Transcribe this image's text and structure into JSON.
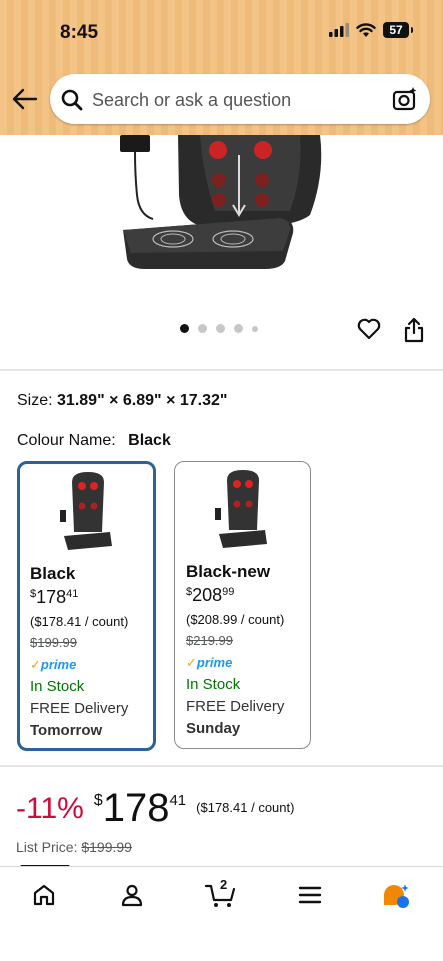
{
  "status_bar": {
    "time": "8:45",
    "battery": "57"
  },
  "search": {
    "placeholder": "Search or ask a question"
  },
  "icons": {
    "back": "back-arrow-icon",
    "search": "search-icon",
    "camera": "camera-search-icon",
    "heart": "heart-icon",
    "share": "share-icon",
    "home": "home-icon",
    "account": "account-icon",
    "cart": "cart-icon",
    "menu": "menu-icon",
    "rufus": "rufus-ai-icon"
  },
  "gallery": {
    "dot_count": 5,
    "active_index": 0
  },
  "product": {
    "size_label": "Size:",
    "size_value": "31.89\" × 6.89\" × 17.32\"",
    "colour_label": "Colour Name:",
    "colour_value": "Black"
  },
  "variants": [
    {
      "name": "Black",
      "currency": "$",
      "price_whole": "178",
      "price_cents": "41",
      "unit_price": "($178.41 / count)",
      "list_price": "$199.99",
      "prime": "prime",
      "stock": "In Stock",
      "delivery": "FREE Delivery",
      "delivery_day": "Tomorrow",
      "selected": true
    },
    {
      "name": "Black-new",
      "currency": "$",
      "price_whole": "208",
      "price_cents": "99",
      "unit_price": "($208.99 / count)",
      "list_price": "$219.99",
      "prime": "prime",
      "stock": "In Stock",
      "delivery": "FREE Delivery",
      "delivery_day": "Sunday",
      "selected": false
    }
  ],
  "price": {
    "discount": "-11%",
    "currency": "$",
    "whole": "178",
    "cents": "41",
    "unit_price": "($178.41 / count)",
    "list_label": "List Price:",
    "list_value": "$199.99"
  },
  "bottom_nav": {
    "cart_count": "2"
  },
  "colors": {
    "header": "#f4c487",
    "discount": "#cc0c39",
    "in_stock": "#007600",
    "prime": "#1a98ff",
    "selected_border": "#2a6496"
  }
}
